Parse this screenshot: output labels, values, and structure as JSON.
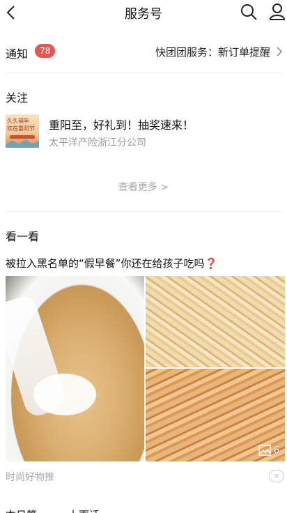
{
  "header": {
    "title": "服务号"
  },
  "notice": {
    "label": "通知",
    "badge": "78",
    "service_text": "快团团服务：新订单提醒"
  },
  "follow": {
    "section_title": "关注",
    "items": [
      {
        "title": "重阳至，好礼到！抽奖速来！",
        "subtitle": "太平洋产险浙江分公司",
        "thumb_line1": "久久福年",
        "thumb_line2": "欢在重阳节"
      }
    ],
    "more_label": "查看更多 >"
  },
  "discover": {
    "section_title": "看一看",
    "article": {
      "title": "被拉入黑名单的“假早餐”你还在给孩子吃吗",
      "title_suffix": "❓",
      "image_count": "6",
      "source": "时尚好物推",
      "close_label": "×"
    },
    "next_title": "本日第一……上面话"
  },
  "colors": {
    "badge": "#ef5350",
    "muted_text": "#a8a8a8",
    "divider": "#ececec"
  },
  "icons": [
    "back-icon",
    "search-icon",
    "user-icon",
    "chevron-right-icon",
    "image-count-icon",
    "close-icon"
  ]
}
